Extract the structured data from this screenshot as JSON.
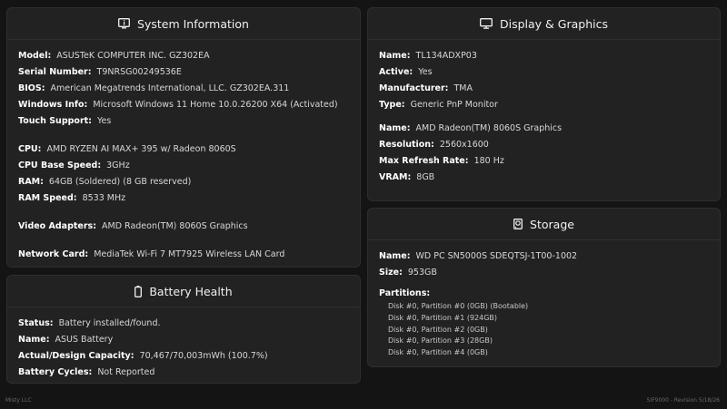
{
  "system": {
    "title": "System Information",
    "icon": "info-screen-icon",
    "rows": [
      {
        "label": "Model:",
        "value": "ASUSTeK COMPUTER INC. GZ302EA"
      },
      {
        "label": "Serial Number:",
        "value": "T9NRSG00249536E"
      },
      {
        "label": "BIOS:",
        "value": "American Megatrends International, LLC. GZ302EA.311"
      },
      {
        "label": "Windows Info:",
        "value": "Microsoft Windows 11 Home 10.0.26200 X64 (Activated)"
      },
      {
        "label": "Touch Support:",
        "value": "Yes"
      },
      {
        "label": "CPU:",
        "value": "AMD RYZEN AI MAX+ 395 w/ Radeon 8060S"
      },
      {
        "label": "CPU Base Speed:",
        "value": "3GHz"
      },
      {
        "label": "RAM:",
        "value": "64GB (Soldered) (8 GB reserved)"
      },
      {
        "label": "RAM Speed:",
        "value": "8533 MHz"
      },
      {
        "label": "Video Adapters:",
        "value": "AMD Radeon(TM) 8060S Graphics"
      },
      {
        "label": "Network Card:",
        "value": "MediaTek Wi-Fi 7 MT7925 Wireless LAN Card"
      }
    ]
  },
  "battery": {
    "title": "Battery Health",
    "icon": "battery-icon",
    "rows": [
      {
        "label": "Status:",
        "value": "Battery installed/found."
      },
      {
        "label": "Name:",
        "value": "ASUS Battery"
      },
      {
        "label": "Actual/Design Capacity:",
        "value": "70,467/70,003mWh (100.7%)"
      },
      {
        "label": "Battery Cycles:",
        "value": "Not Reported"
      }
    ]
  },
  "display": {
    "title": "Display & Graphics",
    "icon": "monitor-icon",
    "rows": [
      {
        "label": "Name:",
        "value": "TL134ADXP03"
      },
      {
        "label": "Active:",
        "value": "Yes"
      },
      {
        "label": "Manufacturer:",
        "value": "TMA"
      },
      {
        "label": "Type:",
        "value": "Generic PnP Monitor"
      },
      {
        "label": "Name:",
        "value": "AMD Radeon(TM) 8060S Graphics"
      },
      {
        "label": "Resolution:",
        "value": "2560x1600"
      },
      {
        "label": "Max Refresh Rate:",
        "value": "180 Hz"
      },
      {
        "label": "VRAM:",
        "value": "8GB"
      }
    ]
  },
  "storage": {
    "title": "Storage",
    "icon": "hard-drive-icon",
    "rows": [
      {
        "label": "Name:",
        "value": "WD PC SN5000S SDEQTSJ-1T00-1002"
      },
      {
        "label": "Size:",
        "value": "953GB"
      }
    ],
    "partitions_label": "Partitions:",
    "partitions": [
      "Disk #0, Partition #0 (0GB) (Bootable)",
      "Disk #0, Partition #1 (924GB)",
      "Disk #0, Partition #2 (0GB)",
      "Disk #0, Partition #3 (28GB)",
      "Disk #0, Partition #4 (0GB)"
    ]
  },
  "footer": {
    "left": "Misty LLC",
    "right": "SIF9000 - Revision 5/18/26"
  }
}
